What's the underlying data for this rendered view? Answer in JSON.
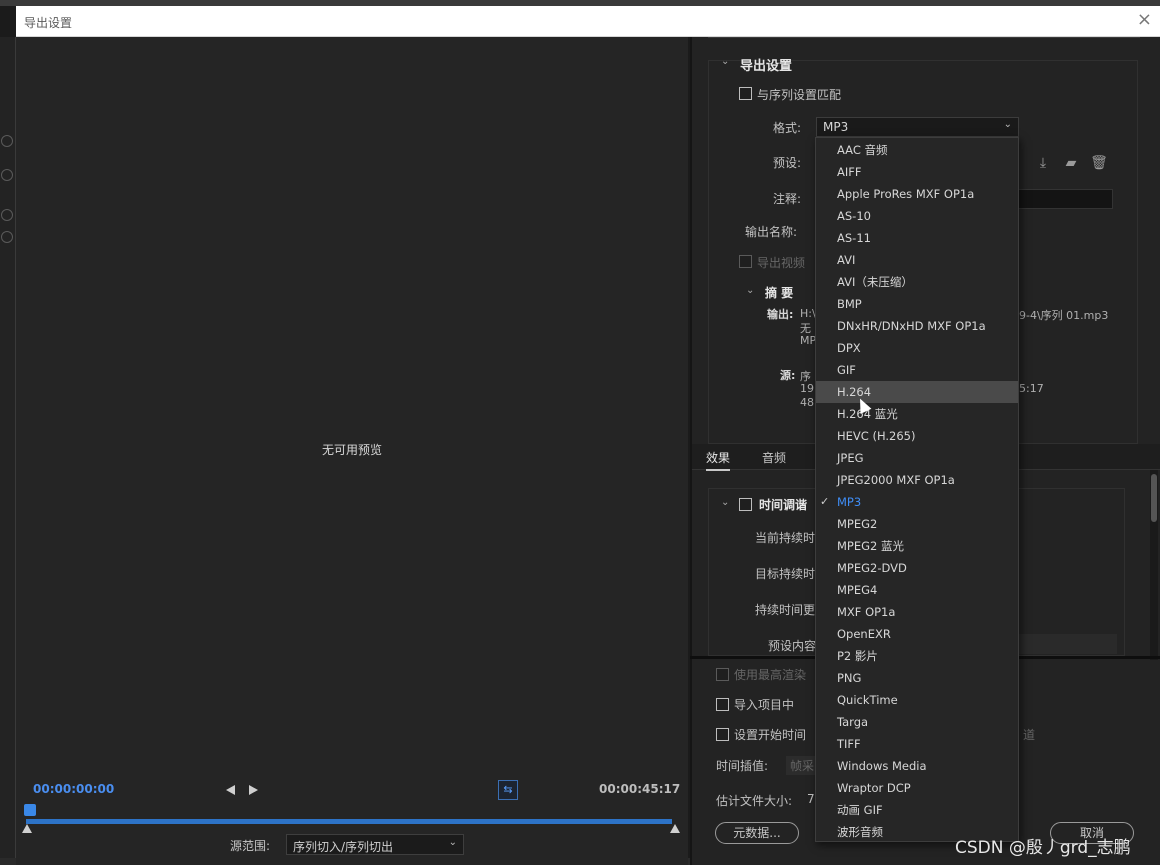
{
  "dialog": {
    "title": "导出设置",
    "close_glyph": "×"
  },
  "preview": {
    "message": "无可用预览",
    "timecode_in": "00:00:00:00",
    "timecode_out": "00:00:45:17",
    "source_range_label": "源范围:",
    "source_range_value": "序列切入/序列切出"
  },
  "export_settings": {
    "title": "导出设置",
    "match_sequence_label": "与序列设置匹配",
    "format_label": "格式:",
    "format_value": "MP3",
    "preset_label": "预设:",
    "comment_label": "注释:",
    "output_name_label": "输出名称:",
    "export_video_label": "导出视频",
    "summary": {
      "title": "摘 要",
      "output_label": "输出:",
      "output_line1": "H:\\",
      "output_line1_tail": "9-4\\序列 01.mp3",
      "output_line2": "无",
      "output_line3": "MP",
      "source_label": "源:",
      "source_line1": "序",
      "source_line1_tail": "5:17",
      "source_line2": "19",
      "source_line3": "48"
    }
  },
  "tabs": [
    {
      "label": "效果"
    },
    {
      "label": "音频"
    }
  ],
  "effects": {
    "time_tuning_label": "时间调谐",
    "current_duration_label": "当前持续时",
    "target_duration_label": "目标持续时",
    "duration_change_label": "持续时间更",
    "preset_content_label": "预设内容"
  },
  "bottom": {
    "max_render_label": "使用最高渲染",
    "import_project_label": "导入项目中",
    "set_start_time_label": "设置开始时间",
    "channel_tail": "道",
    "time_interp_label": "时间插值:",
    "time_interp_value": "帧采",
    "file_size_label": "估计文件大小:",
    "file_size_tail": "7",
    "metadata_button": "元数据...",
    "cancel_button": "取消"
  },
  "format_options": [
    {
      "label": "AAC 音频"
    },
    {
      "label": "AIFF"
    },
    {
      "label": "Apple ProRes MXF OP1a"
    },
    {
      "label": "AS-10"
    },
    {
      "label": "AS-11"
    },
    {
      "label": "AVI"
    },
    {
      "label": "AVI（未压缩）"
    },
    {
      "label": "BMP"
    },
    {
      "label": "DNxHR/DNxHD MXF OP1a"
    },
    {
      "label": "DPX"
    },
    {
      "label": "GIF"
    },
    {
      "label": "H.264",
      "state": "hover"
    },
    {
      "label": "H.264 蓝光"
    },
    {
      "label": "HEVC (H.265)"
    },
    {
      "label": "JPEG"
    },
    {
      "label": "JPEG2000 MXF OP1a"
    },
    {
      "label": "MP3",
      "state": "selected"
    },
    {
      "label": "MPEG2"
    },
    {
      "label": "MPEG2 蓝光"
    },
    {
      "label": "MPEG2-DVD"
    },
    {
      "label": "MPEG4"
    },
    {
      "label": "MXF OP1a"
    },
    {
      "label": "OpenEXR"
    },
    {
      "label": "P2 影片"
    },
    {
      "label": "PNG"
    },
    {
      "label": "QuickTime"
    },
    {
      "label": "Targa"
    },
    {
      "label": "TIFF"
    },
    {
      "label": "Windows Media"
    },
    {
      "label": "Wraptor DCP"
    },
    {
      "label": "动画 GIF"
    },
    {
      "label": "波形音频"
    }
  ],
  "watermark": "CSDN @殷丿grd_志鹏",
  "icons": {
    "save_preset": "download-icon",
    "import_preset": "import-folder-icon",
    "delete_preset": "trash-icon",
    "checkmark": "checkmark-icon"
  }
}
